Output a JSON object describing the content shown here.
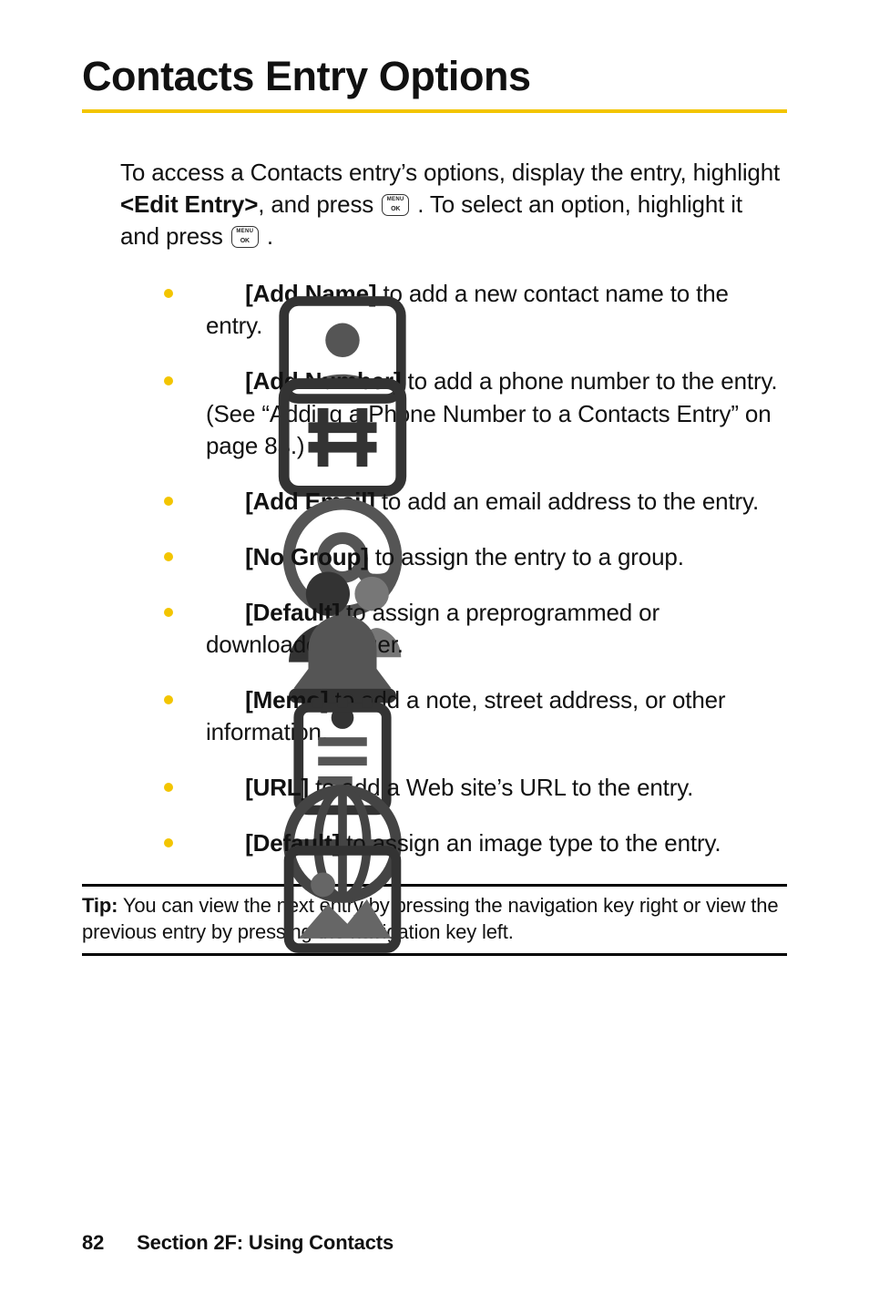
{
  "title": "Contacts Entry Options",
  "intro": {
    "pre": "To access a Contacts entry’s options, display the entry, highlight ",
    "edit_entry": "<Edit Entry>",
    "mid1": ", and press ",
    "mid2": " . To select an option, highlight it and press ",
    "end": " ."
  },
  "options": [
    {
      "icon": "contact-card-icon",
      "label": "[Add Name]",
      "text": " to add a new contact name to the entry."
    },
    {
      "icon": "hash-pad-icon",
      "label": "[Add Number]",
      "text": " to add a phone number to the entry. (See “Adding a Phone Number to a Contacts Entry” on page 83.)"
    },
    {
      "icon": "at-sign-icon",
      "label": "[Add Email]",
      "text": " to add an email address to the entry."
    },
    {
      "icon": "group-silhouette-icon",
      "label": "[No Group]",
      "text": " to assign the entry to a group."
    },
    {
      "icon": "bell-icon",
      "label": "[Default]",
      "text": " to assign a preprogrammed or downloaded ringer."
    },
    {
      "icon": "memo-pad-icon",
      "label": "[Memo]",
      "text": " to add a note, street address, or other information."
    },
    {
      "icon": "globe-icon",
      "label": "[URL]",
      "text": " to add a Web site’s URL to the entry."
    },
    {
      "icon": "picture-frame-icon",
      "label": "[Default]",
      "text": " to assign an image type to the entry."
    }
  ],
  "tip": {
    "label": "Tip:",
    "text": " You can view the next entry by pressing the navigation key right or view the previous entry by pressing the navigation key left."
  },
  "footer": {
    "page_number": "82",
    "section": "Section 2F: Using Contacts"
  }
}
